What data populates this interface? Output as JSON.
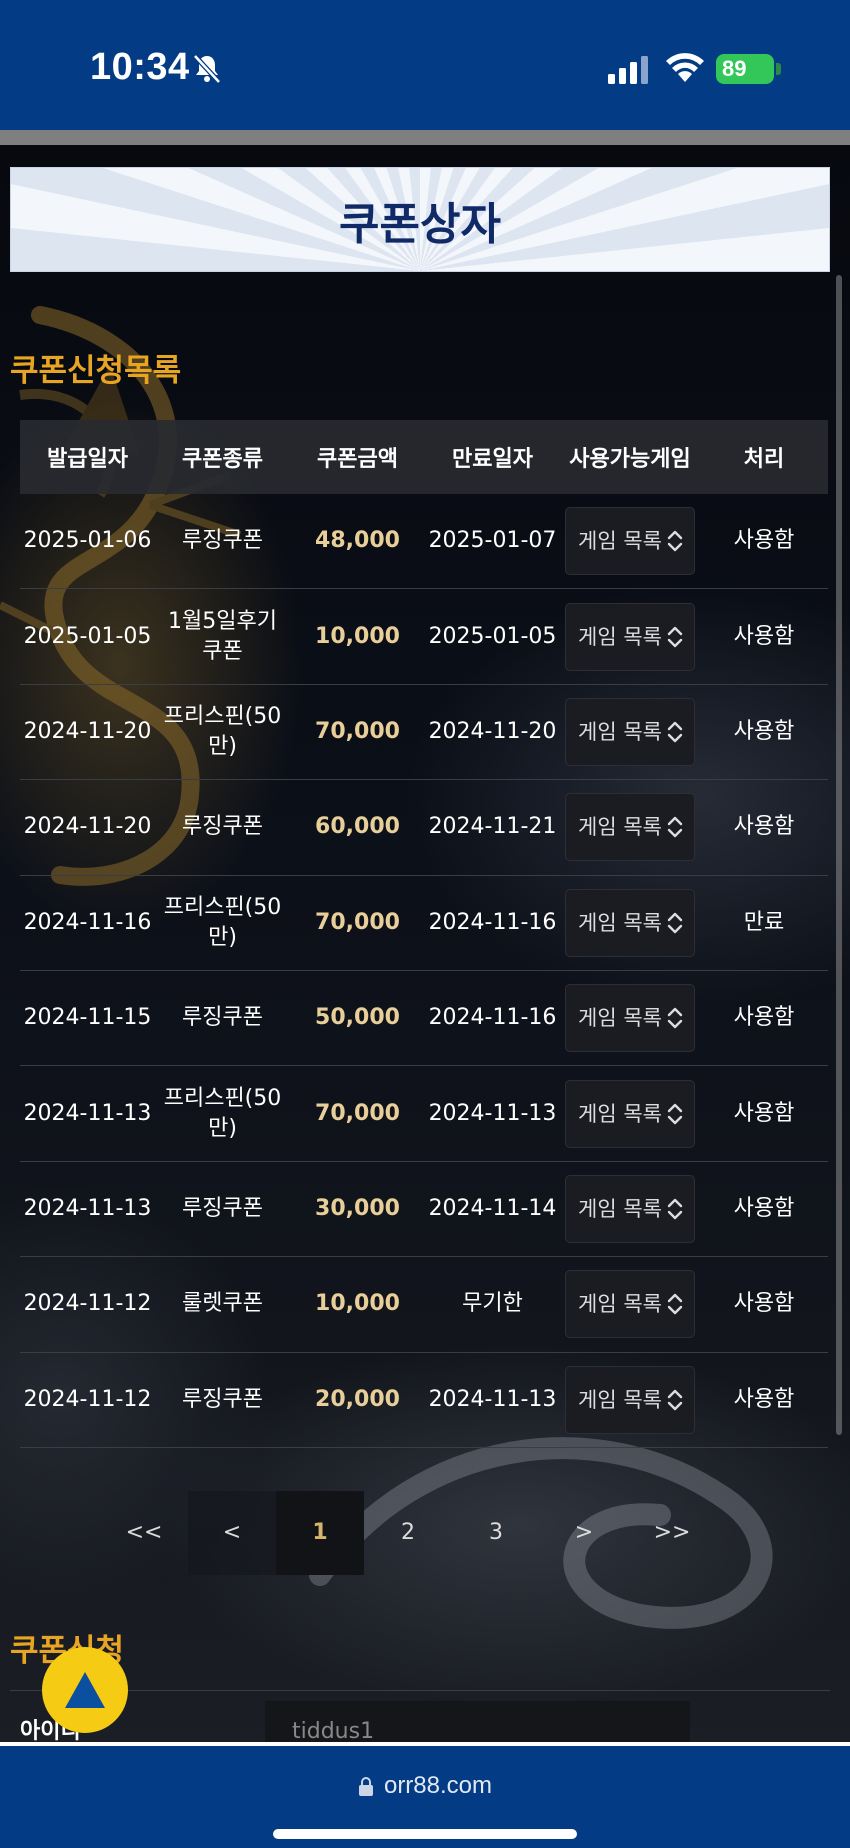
{
  "status_bar": {
    "time": "10:34",
    "battery": "89"
  },
  "page": {
    "title": "쿠폰상자",
    "list_heading": "쿠폰신청목록",
    "apply_heading": "쿠폰신청"
  },
  "table": {
    "headers": [
      "발급일자",
      "쿠폰종류",
      "쿠폰금액",
      "만료일자",
      "사용가능게임",
      "처리"
    ],
    "rows": [
      {
        "issued": "2025-01-06",
        "type": "루징쿠폰",
        "amount": "48,000",
        "expires": "2025-01-07",
        "game": "게임 목록",
        "status": "사용함"
      },
      {
        "issued": "2025-01-05",
        "type": "1월5일후기쿠폰",
        "amount": "10,000",
        "expires": "2025-01-05",
        "game": "게임 목록",
        "status": "사용함"
      },
      {
        "issued": "2024-11-20",
        "type": "프리스핀(50만)",
        "amount": "70,000",
        "expires": "2024-11-20",
        "game": "게임 목록",
        "status": "사용함"
      },
      {
        "issued": "2024-11-20",
        "type": "루징쿠폰",
        "amount": "60,000",
        "expires": "2024-11-21",
        "game": "게임 목록",
        "status": "사용함"
      },
      {
        "issued": "2024-11-16",
        "type": "프리스핀(50만)",
        "amount": "70,000",
        "expires": "2024-11-16",
        "game": "게임 목록",
        "status": "만료"
      },
      {
        "issued": "2024-11-15",
        "type": "루징쿠폰",
        "amount": "50,000",
        "expires": "2024-11-16",
        "game": "게임 목록",
        "status": "사용함"
      },
      {
        "issued": "2024-11-13",
        "type": "프리스핀(50만)",
        "amount": "70,000",
        "expires": "2024-11-13",
        "game": "게임 목록",
        "status": "사용함"
      },
      {
        "issued": "2024-11-13",
        "type": "루징쿠폰",
        "amount": "30,000",
        "expires": "2024-11-14",
        "game": "게임 목록",
        "status": "사용함"
      },
      {
        "issued": "2024-11-12",
        "type": "룰렛쿠폰",
        "amount": "10,000",
        "expires": "무기한",
        "game": "게임 목록",
        "status": "사용함"
      },
      {
        "issued": "2024-11-12",
        "type": "루징쿠폰",
        "amount": "20,000",
        "expires": "2024-11-13",
        "game": "게임 목록",
        "status": "사용함"
      }
    ]
  },
  "pagination": {
    "first": "<<",
    "prev": "<",
    "pages": [
      "1",
      "2",
      "3"
    ],
    "current": "1",
    "next": ">",
    "last": ">>"
  },
  "apply_form": {
    "id_label": "아이디",
    "id_value": "tiddus1"
  },
  "browser": {
    "url": "orr88.com"
  },
  "colors": {
    "header_blue": "#033c84",
    "accent_gold": "#e8a523",
    "amount_gold": "#e8cf9a",
    "scroll_button": "#f6cb13"
  }
}
